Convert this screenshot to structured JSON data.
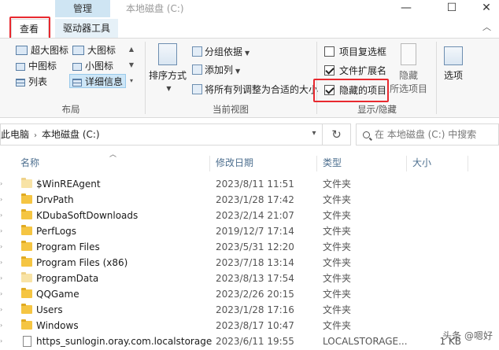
{
  "titlebar": {
    "context_tab": "管理",
    "window_title": "本地磁盘 (C:)",
    "minimize": "—",
    "maximize": "☐",
    "close": "✕"
  },
  "tabs": {
    "view": "查看",
    "drive_tools": "驱动器工具",
    "collapse": "︿"
  },
  "ribbon": {
    "layout": {
      "label": "布局",
      "items": [
        "超大图标",
        "大图标",
        "中图标",
        "小图标",
        "列表",
        "详细信息"
      ],
      "selected": "详细信息"
    },
    "current_view": {
      "label": "当前视图",
      "sort_button": "排序方式",
      "group_by": "分组依据",
      "add_column": "添加列",
      "fit_columns": "将所有列调整为合适的大小"
    },
    "show_hide": {
      "label": "显示/隐藏",
      "item_checkboxes": "项目复选框",
      "file_extensions": "文件扩展名",
      "hidden_items": "隐藏的项目",
      "item_checkboxes_checked": false,
      "file_extensions_checked": true,
      "hidden_items_checked": true,
      "hide_selected_top": "隐藏",
      "hide_selected_bottom": "所选项目",
      "options": "选项"
    }
  },
  "address": {
    "crumb1": "此电脑",
    "crumb2": "本地磁盘 (C:)",
    "refresh": "↻",
    "search_placeholder": "在 本地磁盘 (C:) 中搜索"
  },
  "columns": {
    "name": "名称",
    "modified": "修改日期",
    "type": "类型",
    "size": "大小"
  },
  "files": [
    {
      "name": "$WinREAgent",
      "date": "2023/8/11 11:51",
      "type": "文件夹",
      "size": "",
      "kind": "folder",
      "hidden": true
    },
    {
      "name": "DrvPath",
      "date": "2023/1/28 17:42",
      "type": "文件夹",
      "size": "",
      "kind": "folder",
      "hidden": false
    },
    {
      "name": "KDubaSoftDownloads",
      "date": "2023/2/14 21:07",
      "type": "文件夹",
      "size": "",
      "kind": "folder",
      "hidden": false
    },
    {
      "name": "PerfLogs",
      "date": "2019/12/7 17:14",
      "type": "文件夹",
      "size": "",
      "kind": "folder",
      "hidden": false
    },
    {
      "name": "Program Files",
      "date": "2023/5/31 12:20",
      "type": "文件夹",
      "size": "",
      "kind": "folder",
      "hidden": false
    },
    {
      "name": "Program Files (x86)",
      "date": "2023/7/18 13:14",
      "type": "文件夹",
      "size": "",
      "kind": "folder",
      "hidden": false
    },
    {
      "name": "ProgramData",
      "date": "2023/8/13 17:54",
      "type": "文件夹",
      "size": "",
      "kind": "folder",
      "hidden": true
    },
    {
      "name": "QQGame",
      "date": "2023/2/26 20:15",
      "type": "文件夹",
      "size": "",
      "kind": "folder",
      "hidden": false
    },
    {
      "name": "Users",
      "date": "2023/1/28 17:16",
      "type": "文件夹",
      "size": "",
      "kind": "folder",
      "hidden": false
    },
    {
      "name": "Windows",
      "date": "2023/8/17 10:47",
      "type": "文件夹",
      "size": "",
      "kind": "folder",
      "hidden": false
    },
    {
      "name": "https_sunlogin.oray.com.localstorage",
      "date": "2023/6/11 19:55",
      "type": "LOCALSTORAGE...",
      "size": "1 KB",
      "kind": "file",
      "hidden": false
    }
  ],
  "watermark": "头条 @嗯好",
  "colors": {
    "highlight_red": "#e8292f",
    "context_tab_bg": "#cfe5f3",
    "folder": "#f5c542",
    "selected_layout": "#cde6f7"
  }
}
